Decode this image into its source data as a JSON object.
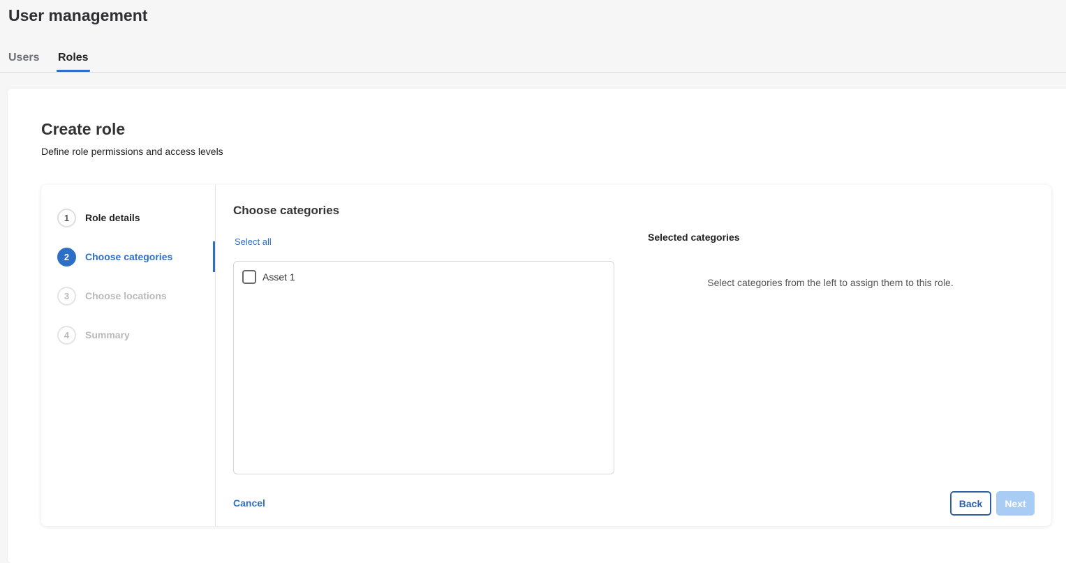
{
  "header": {
    "title": "User management"
  },
  "tabs": [
    {
      "label": "Users",
      "active": false
    },
    {
      "label": "Roles",
      "active": true
    }
  ],
  "form": {
    "title": "Create role",
    "subtitle": "Define role permissions and access levels"
  },
  "steps": [
    {
      "number": "1",
      "label": "Role details",
      "state": "completed"
    },
    {
      "number": "2",
      "label": "Choose categories",
      "state": "active"
    },
    {
      "number": "3",
      "label": "Choose locations",
      "state": "disabled"
    },
    {
      "number": "4",
      "label": "Summary",
      "state": "disabled"
    }
  ],
  "categories": {
    "title": "Choose categories",
    "select_all": "Select all",
    "items": [
      {
        "label": "Asset 1",
        "checked": false
      }
    ]
  },
  "selected": {
    "title": "Selected categories",
    "empty_message": "Select categories from the left to assign them to this role."
  },
  "actions": {
    "cancel": "Cancel",
    "back": "Back",
    "next": "Next"
  },
  "colors": {
    "accent": "#2d6fc6",
    "next_disabled": "#a9ccf5"
  }
}
